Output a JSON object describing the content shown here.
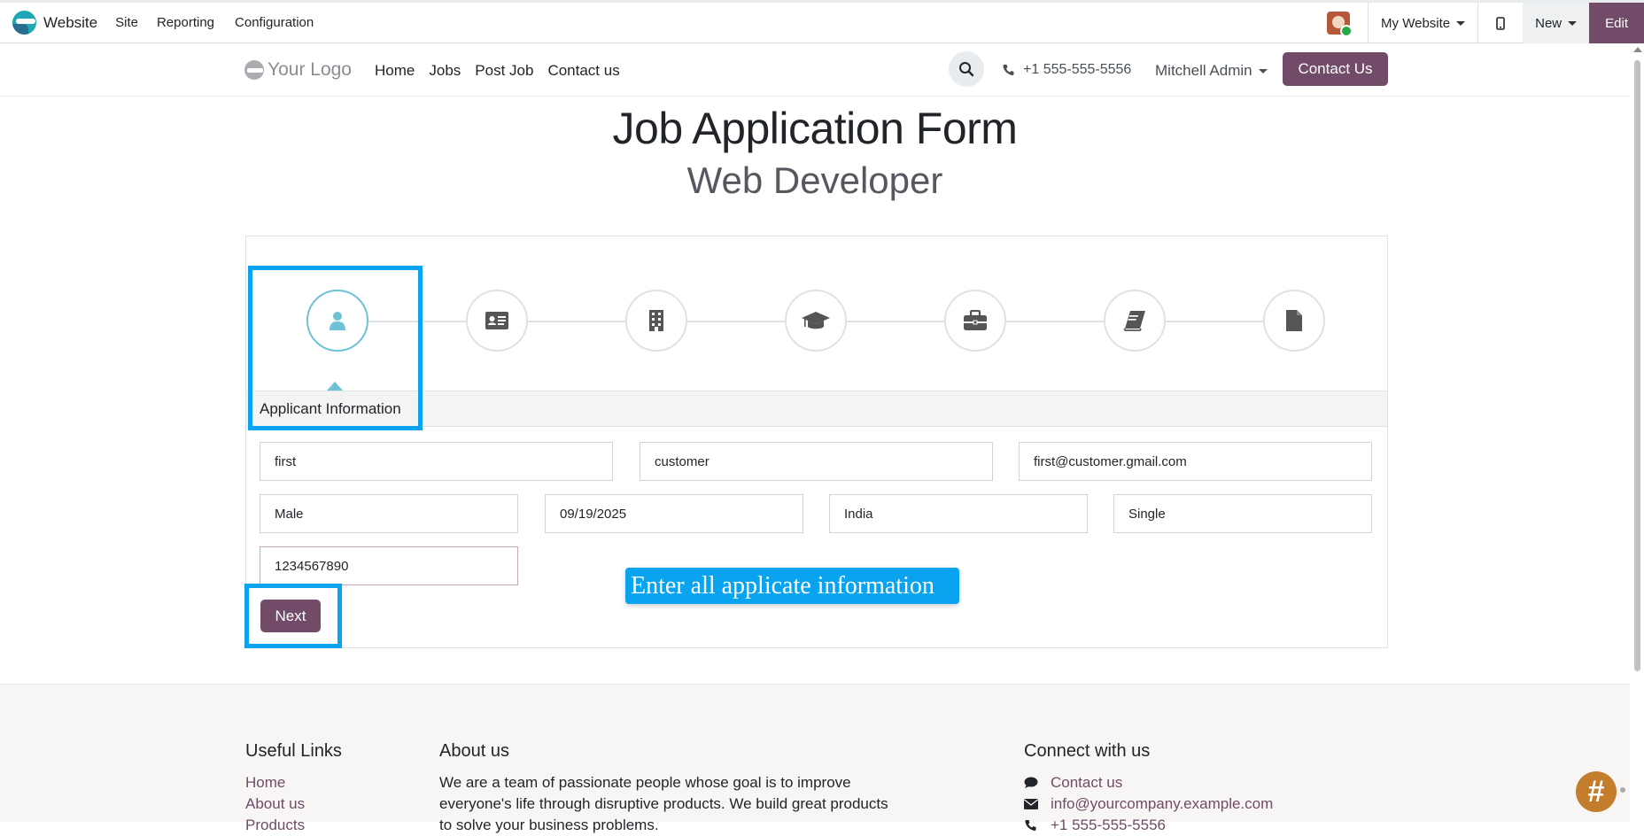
{
  "topbar": {
    "app_name": "Website",
    "menus": [
      "Site",
      "Reporting",
      "Configuration"
    ],
    "website_selector": "My Website",
    "new_label": "New",
    "edit_label": "Edit"
  },
  "header": {
    "logo_text": "Your Logo",
    "nav": [
      "Home",
      "Jobs",
      "Post Job",
      "Contact us"
    ],
    "phone": "+1 555-555-5556",
    "user": "Mitchell Admin",
    "contact_button": "Contact Us"
  },
  "form": {
    "title": "Job Application Form",
    "subtitle": "Web Developer",
    "steps": [
      "user-icon",
      "id-card-icon",
      "building-icon",
      "graduation-cap-icon",
      "briefcase-icon",
      "book-icon",
      "file-icon"
    ],
    "active_step_label": "Applicant Information",
    "fields": {
      "first_name": "first",
      "last_name": "customer",
      "email": "first@customer.gmail.com",
      "gender": "Male",
      "dob": "09/19/2025",
      "country": "India",
      "marital_status": "Single",
      "phone": "1234567890"
    },
    "next_label": "Next"
  },
  "tooltip": "Enter all applicate information",
  "footer": {
    "useful_links_title": "Useful Links",
    "useful_links": [
      "Home",
      "About us",
      "Products"
    ],
    "about_title": "About us",
    "about_lines": [
      "We are a team of passionate people whose goal is to improve",
      "everyone's life through disruptive products. We build great products",
      "to solve your business problems."
    ],
    "connect_title": "Connect with us",
    "connect_items": [
      "Contact us",
      "info@yourcompany.example.com",
      "+1 555-555-5556"
    ]
  },
  "colors": {
    "brand": "#714b67",
    "highlight": "#0aa3f0",
    "step_active": "#6dc2d8"
  }
}
